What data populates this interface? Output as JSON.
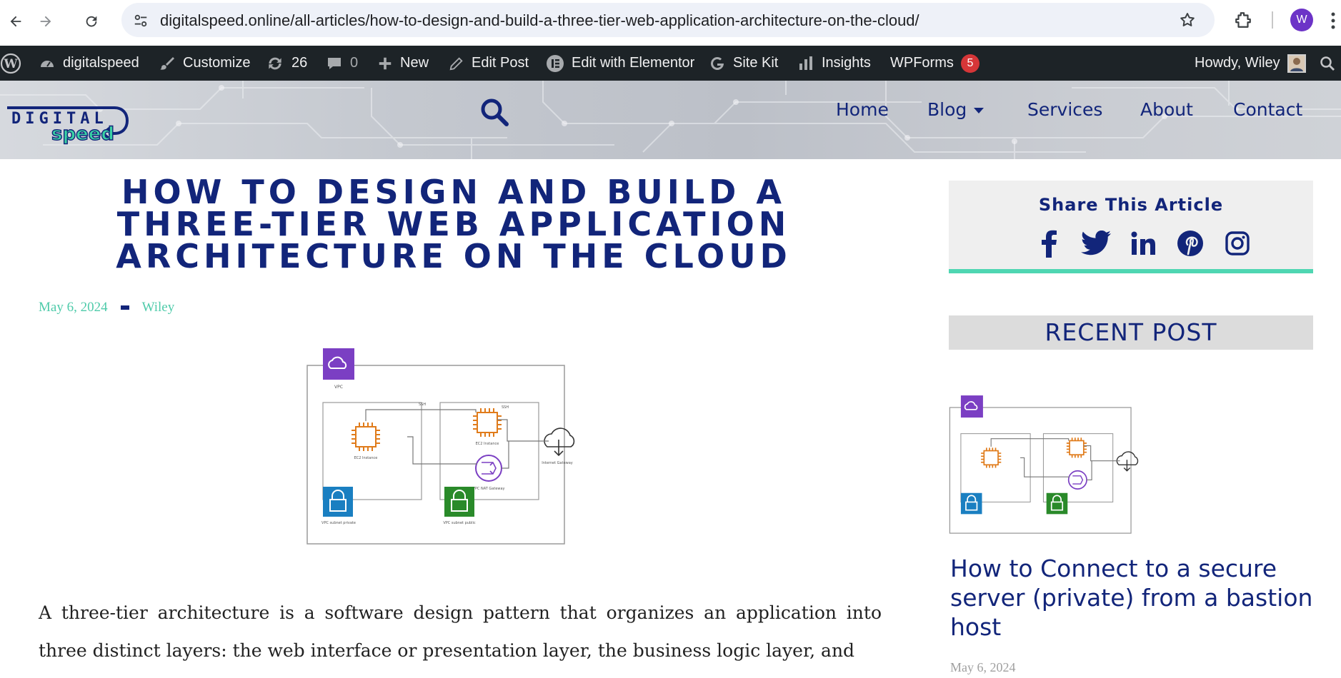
{
  "browser": {
    "url": "digitalspeed.online/all-articles/how-to-design-and-build-a-three-tier-web-application-architecture-on-the-cloud/",
    "profile_initial": "W"
  },
  "adminbar": {
    "site_name": "digitalspeed",
    "customize": "Customize",
    "updates_count": "26",
    "comments_count": "0",
    "new": "New",
    "edit_post": "Edit Post",
    "edit_elementor": "Edit with Elementor",
    "site_kit": "Site Kit",
    "insights": "Insights",
    "wpforms": "WPForms",
    "wpforms_badge": "5",
    "howdy": "Howdy, Wiley"
  },
  "header": {
    "logo_top": "DIGITAL",
    "logo_bottom": "speed",
    "nav": [
      "Home",
      "Blog",
      "Services",
      "About",
      "Contact"
    ]
  },
  "article": {
    "title": "HOW TO DESIGN AND BUILD A THREE-TIER WEB APPLICATION ARCHITECTURE ON THE CLOUD",
    "date": "May 6, 2024",
    "author": "Wiley",
    "diagram": {
      "vpc_label": "VPC",
      "ssh_label": "SSH",
      "ec2_label": "EC2 Instance",
      "nat_label": "VPC NAT Gateway",
      "igw_label": "Internet Gateway",
      "private_subnet_label": "VPC subnet private",
      "public_subnet_label": "VPC subnet public"
    },
    "body": "A three-tier architecture is a software design pattern that organizes an application into three distinct layers: the web interface or presentation layer, the business logic layer, and"
  },
  "sidebar": {
    "share_title": "Share This Article",
    "share_icons": [
      "facebook-icon",
      "twitter-icon",
      "linkedin-icon",
      "pinterest-icon",
      "instagram-icon"
    ],
    "recent_heading": "RECENT POST",
    "recent_post_title": "How to Connect to a secure server (private) from a bastion host",
    "recent_post_date": "May 6, 2024"
  },
  "colors": {
    "brand_navy": "#12257a",
    "accent_teal": "#4fcbaa",
    "admin_bar": "#1d2327",
    "badge_red": "#d63638",
    "aws_purple": "#7b3fc3",
    "aws_orange": "#e07b1a",
    "aws_blue": "#1a7fc1",
    "aws_green": "#2a8a2a"
  }
}
